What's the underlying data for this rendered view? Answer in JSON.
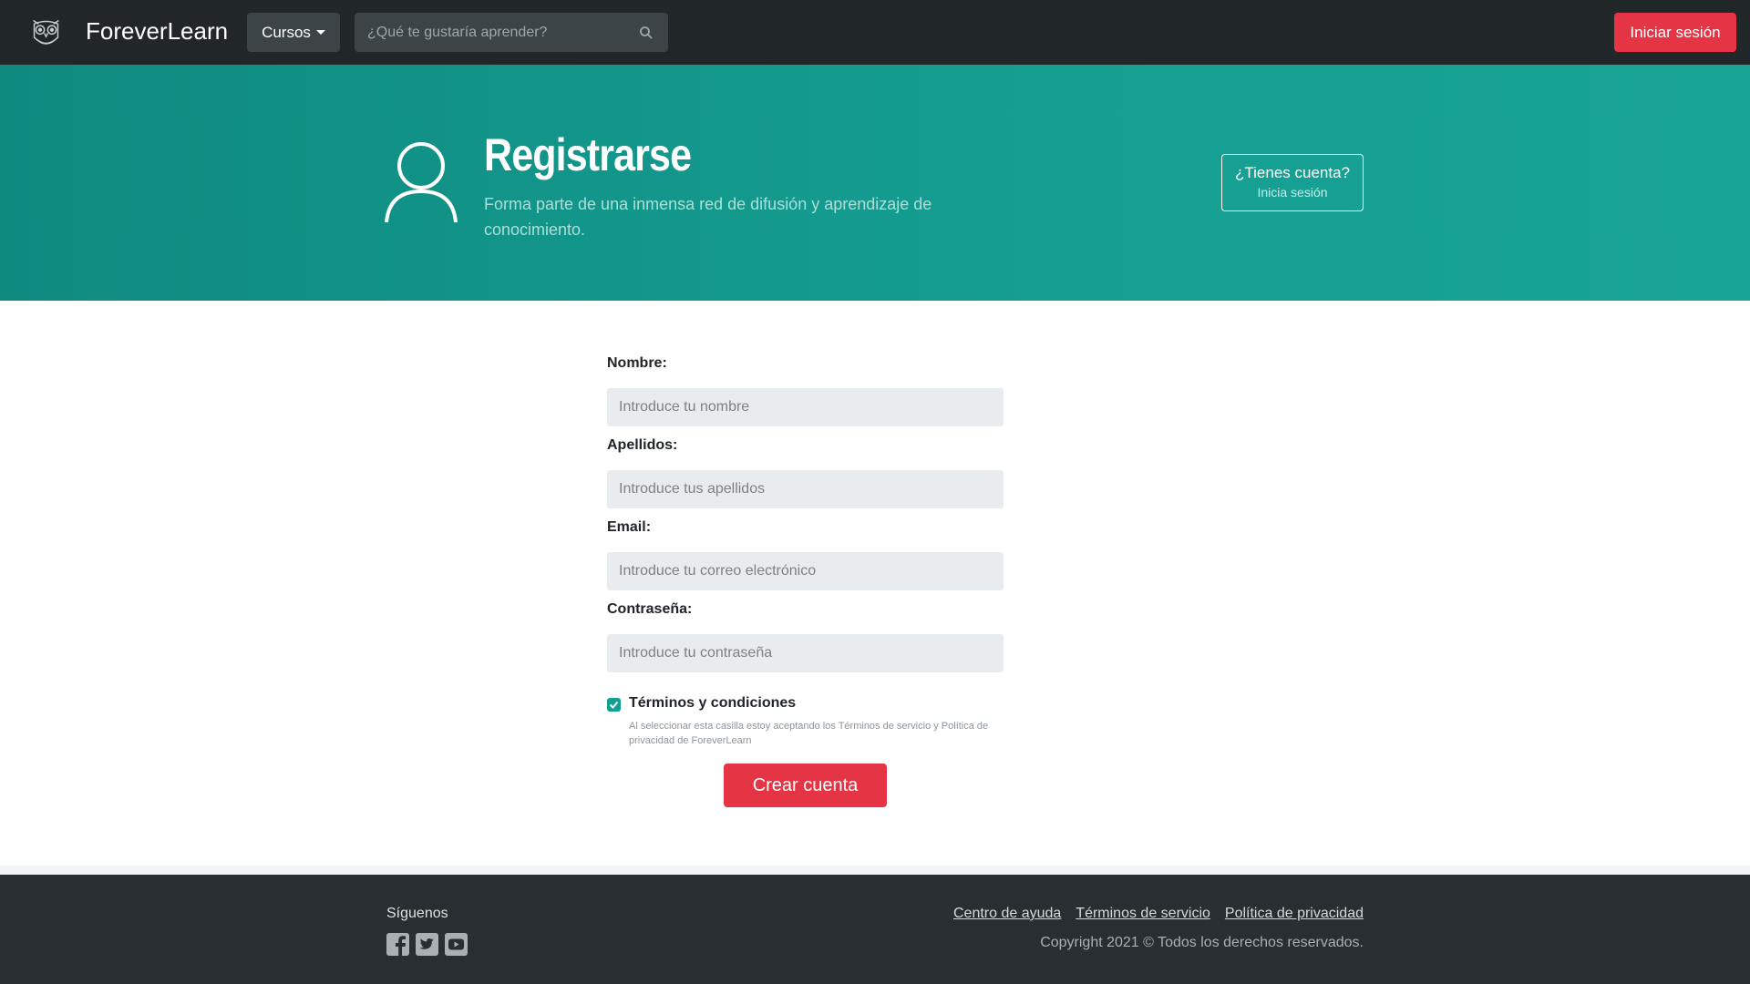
{
  "navbar": {
    "brand": "ForeverLearn",
    "courses_label": "Cursos",
    "search_placeholder": "¿Qué te gustaría aprender?",
    "login_label": "Iniciar sesión"
  },
  "hero": {
    "title": "Registrarse",
    "subtitle": "Forma parte de una inmensa red de difusión y aprendizaje de conocimiento.",
    "have_account_title": "¿Tienes cuenta?",
    "have_account_sub": "Inicia sesión"
  },
  "form": {
    "fields": [
      {
        "label": "Nombre:",
        "placeholder": "Introduce tu nombre"
      },
      {
        "label": "Apellidos:",
        "placeholder": "Introduce tus apellidos"
      },
      {
        "label": "Email:",
        "placeholder": "Introduce tu correo electrónico"
      },
      {
        "label": "Contraseña:",
        "placeholder": "Introduce tu contraseña"
      }
    ],
    "terms_label": "Términos y condiciones",
    "terms_checked": true,
    "terms_note": "Al seleccionar esta casilla estoy aceptando los Términos de servicio y Política de privacidad de ForeverLearn",
    "submit_label": "Crear cuenta"
  },
  "footer": {
    "follow_label": "Síguenos",
    "social_icons": [
      "facebook-icon",
      "twitter-icon",
      "youtube-icon"
    ],
    "links": [
      "Centro de ayuda",
      "Términos de servicio",
      "Política de privacidad"
    ],
    "copyright": "Copyright 2021 © Todos los derechos reservados."
  },
  "colors": {
    "navbar_bg": "#212628",
    "accent_red": "#e53444",
    "hero_teal": "#159e92",
    "footer_bg": "#282e31"
  }
}
